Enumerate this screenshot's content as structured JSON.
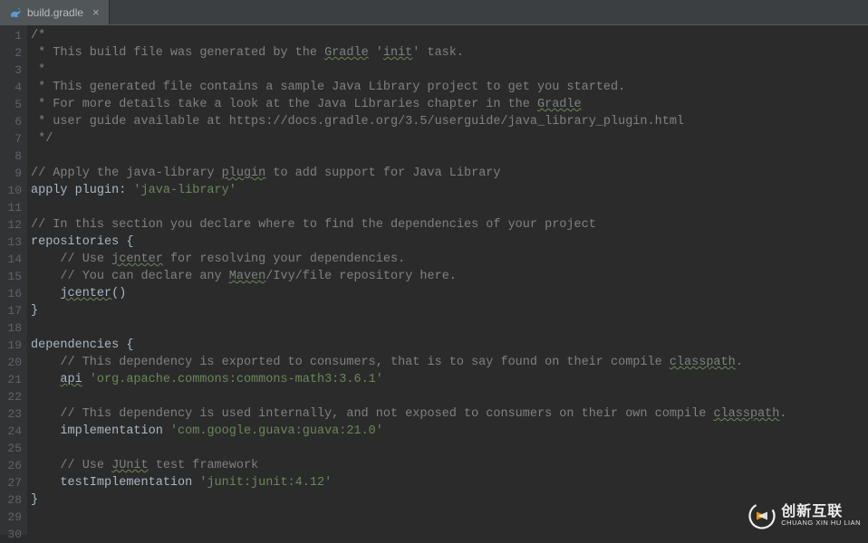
{
  "tab": {
    "filename": "build.gradle",
    "icon": "gradle-icon"
  },
  "code": {
    "lines": [
      {
        "n": 1,
        "type": "comment",
        "text": "/*"
      },
      {
        "n": 2,
        "type": "comment",
        "prefix": " * This build file was generated by the ",
        "typo1": "Gradle",
        "mid": " '",
        "typo2": "init",
        "suffix": "' task."
      },
      {
        "n": 3,
        "type": "comment",
        "text": " *"
      },
      {
        "n": 4,
        "type": "comment",
        "text": " * This generated file contains a sample Java Library project to get you started."
      },
      {
        "n": 5,
        "type": "comment",
        "prefix": " * For more details take a look at the Java Libraries chapter in the ",
        "typo1": "Gradle",
        "suffix": ""
      },
      {
        "n": 6,
        "type": "comment",
        "text": " * user guide available at https://docs.gradle.org/3.5/userguide/java_library_plugin.html"
      },
      {
        "n": 7,
        "type": "comment",
        "text": " */"
      },
      {
        "n": 8,
        "type": "blank",
        "text": ""
      },
      {
        "n": 9,
        "type": "linecomment",
        "prefix": "// Apply the java-library ",
        "typo1": "plugin",
        "suffix": " to add support for Java Library"
      },
      {
        "n": 10,
        "type": "stmt",
        "word1": "apply ",
        "word2": "plugin",
        "word3": ": ",
        "str": "'java-library'"
      },
      {
        "n": 11,
        "type": "blank",
        "text": ""
      },
      {
        "n": 12,
        "type": "linecomment",
        "text": "// In this section you declare where to find the dependencies of your project"
      },
      {
        "n": 13,
        "type": "stmt",
        "word1": "repositories ",
        "word2": "{"
      },
      {
        "n": 14,
        "type": "linecomment-indent",
        "prefix": "    // Use ",
        "typo1": "jcenter",
        "suffix": " for resolving your dependencies."
      },
      {
        "n": 15,
        "type": "linecomment-indent",
        "prefix": "    // You can declare any ",
        "typo1": "Maven",
        "suffix": "/Ivy/file repository here."
      },
      {
        "n": 16,
        "type": "stmt-indent",
        "indent": "    ",
        "typo1": "jcenter",
        "paren": "()"
      },
      {
        "n": 17,
        "type": "stmt",
        "word1": "}"
      },
      {
        "n": 18,
        "type": "blank",
        "text": ""
      },
      {
        "n": 19,
        "type": "stmt",
        "word1": "dependencies ",
        "word2": "{"
      },
      {
        "n": 20,
        "type": "linecomment-indent",
        "prefix": "    // This dependency is exported to consumers, that is to say found on their compile ",
        "typo1": "classpath",
        "suffix": "."
      },
      {
        "n": 21,
        "type": "stmt-indent",
        "indent": "    ",
        "typo1": "api",
        "sp": " ",
        "str": "'org.apache.commons:commons-math3:3.6.1'"
      },
      {
        "n": 22,
        "type": "blank",
        "text": ""
      },
      {
        "n": 23,
        "type": "linecomment-indent",
        "prefix": "    // This dependency is used internally, and not exposed to consumers on their own compile ",
        "typo1": "classpath",
        "suffix": "."
      },
      {
        "n": 24,
        "type": "stmt-indent",
        "indent": "    ",
        "word1": "implementation ",
        "str": "'com.google.guava:guava:21.0'"
      },
      {
        "n": 25,
        "type": "blank",
        "text": ""
      },
      {
        "n": 26,
        "type": "linecomment-indent",
        "prefix": "    // Use ",
        "typo1": "JUnit",
        "suffix": " test framework"
      },
      {
        "n": 27,
        "type": "stmt-indent",
        "indent": "    ",
        "word1": "testImplementation ",
        "str": "'junit:junit:4.12'"
      },
      {
        "n": 28,
        "type": "stmt",
        "word1": "}"
      },
      {
        "n": 29,
        "type": "blank",
        "text": ""
      },
      {
        "n": 30,
        "type": "blank",
        "text": ""
      }
    ]
  },
  "watermark": {
    "cn": "创新互联",
    "en": "CHUANG XIN HU LIAN"
  }
}
